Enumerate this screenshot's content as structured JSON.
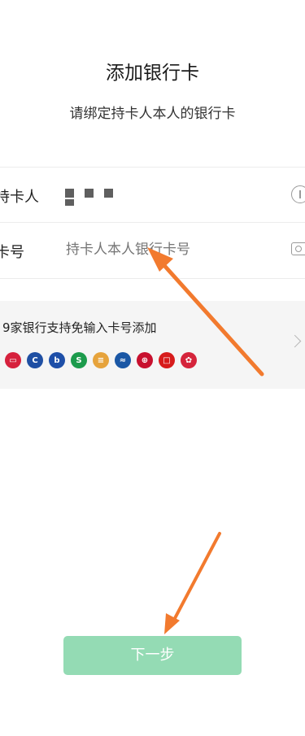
{
  "page": {
    "title": "添加银行卡",
    "subtitle": "请绑定持卡人本人的银行卡"
  },
  "form": {
    "holder_label": "持卡人",
    "card_label": "卡号",
    "card_placeholder": "持卡人本人银行卡号",
    "holder_icon": "info-icon",
    "card_icon": "camera-icon"
  },
  "bank_panel": {
    "text": "9家银行支持免输入卡号添加",
    "banks": [
      {
        "icon": "bank-icon-1",
        "color": "#d6213d",
        "glyph": "▭"
      },
      {
        "icon": "bank-icon-2",
        "color": "#1f4fa3",
        "glyph": "C"
      },
      {
        "icon": "bank-icon-3",
        "color": "#1e4fa8",
        "glyph": "b"
      },
      {
        "icon": "bank-icon-4",
        "color": "#1c9b4c",
        "glyph": "S"
      },
      {
        "icon": "bank-icon-5",
        "color": "#e6a33c",
        "glyph": "≡"
      },
      {
        "icon": "bank-icon-6",
        "color": "#1a57a5",
        "glyph": "≈"
      },
      {
        "icon": "bank-icon-7",
        "color": "#c8102e",
        "glyph": "⊕"
      },
      {
        "icon": "bank-icon-8",
        "color": "#d71c1c",
        "glyph": "□"
      },
      {
        "icon": "bank-icon-9",
        "color": "#d5243b",
        "glyph": "✿"
      }
    ]
  },
  "next_button": {
    "label": "下一步",
    "color": "#94dbb4"
  },
  "annotations": {
    "arrow_color": "#f27a2e"
  }
}
